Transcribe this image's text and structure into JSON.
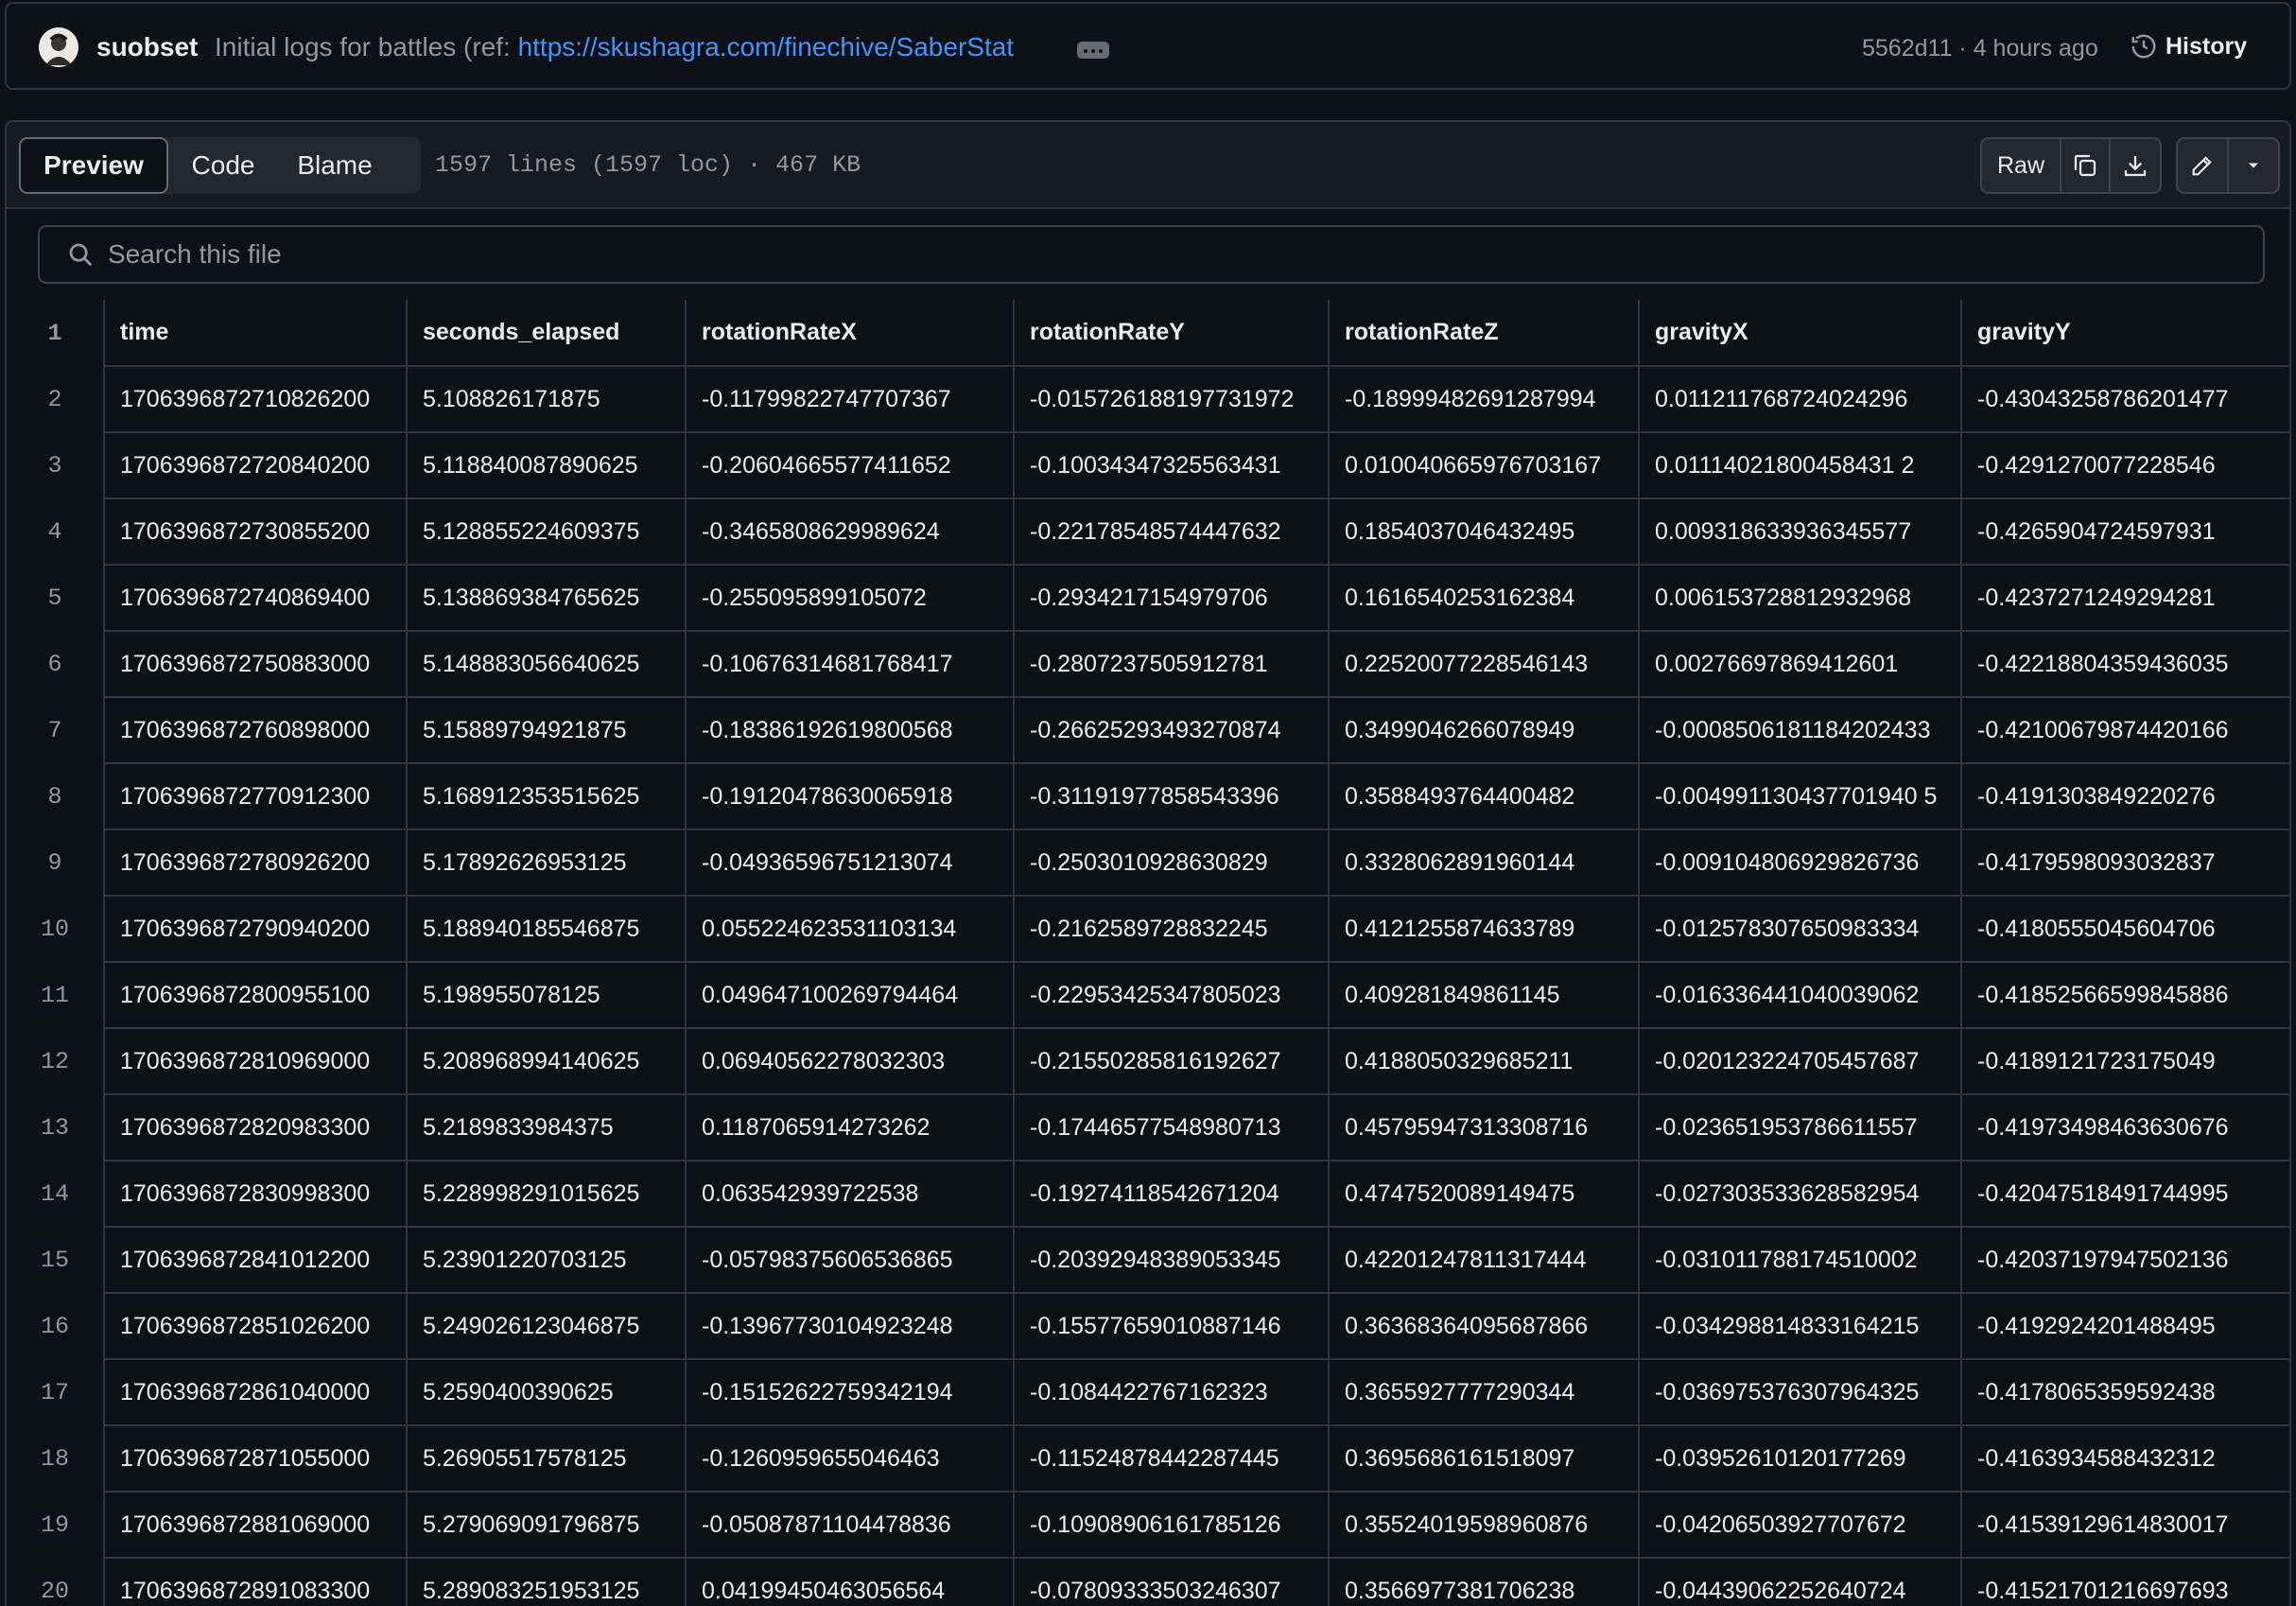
{
  "commit": {
    "author": "suobset",
    "message_prefix": "Initial logs for battles (ref: ",
    "message_link": "https://skushagra.com/finechive/SaberStat",
    "sha_time": "5562d11 · 4 hours ago",
    "history_label": "History"
  },
  "file_header": {
    "tabs": [
      "Preview",
      "Code",
      "Blame"
    ],
    "active_tab": "Preview",
    "info": "1597 lines (1597 loc) · 467 KB",
    "raw_label": "Raw"
  },
  "search": {
    "placeholder": "Search this file"
  },
  "table": {
    "header_line": "1",
    "columns": [
      "time",
      "seconds_elapsed",
      "rotationRateX",
      "rotationRateY",
      "rotationRateZ",
      "gravityX",
      "gravityY"
    ],
    "rows": [
      {
        "line": "2",
        "cells": [
          "1706396872710826200",
          "5.108826171875",
          "-0.11799822747707367",
          "-0.015726188197731972",
          "-0.18999482691287994",
          "0.011211768724024296",
          "-0.43043258786201477"
        ]
      },
      {
        "line": "3",
        "cells": [
          "1706396872720840200",
          "5.118840087890625",
          "-0.20604665577411652",
          "-0.10034347325563431",
          "0.010040665976703167",
          "0.01114021800458431 2",
          "-0.4291270077228546"
        ]
      },
      {
        "line": "4",
        "cells": [
          "1706396872730855200",
          "5.128855224609375",
          "-0.3465808629989624",
          "-0.22178548574447632",
          "0.1854037046432495",
          "0.009318633936345577",
          "-0.4265904724597931"
        ]
      },
      {
        "line": "5",
        "cells": [
          "1706396872740869400",
          "5.138869384765625",
          "-0.255095899105072",
          "-0.2934217154979706",
          "0.1616540253162384",
          "0.006153728812932968",
          "-0.4237271249294281"
        ]
      },
      {
        "line": "6",
        "cells": [
          "1706396872750883000",
          "5.148883056640625",
          "-0.10676314681768417",
          "-0.2807237505912781",
          "0.22520077228546143",
          "0.00276697869412601",
          "-0.42218804359436035"
        ]
      },
      {
        "line": "7",
        "cells": [
          "1706396872760898000",
          "5.15889794921875",
          "-0.18386192619800568",
          "-0.26625293493270874",
          "0.3499046266078949",
          "-0.0008506181184202433",
          "-0.42100679874420166"
        ]
      },
      {
        "line": "8",
        "cells": [
          "1706396872770912300",
          "5.168912353515625",
          "-0.19120478630065918",
          "-0.31191977858543396",
          "0.3588493764400482",
          "-0.004991130437701940 5",
          "-0.4191303849220276"
        ]
      },
      {
        "line": "9",
        "cells": [
          "1706396872780926200",
          "5.17892626953125",
          "-0.04936596751213074",
          "-0.2503010928630829",
          "0.3328062891960144",
          "-0.009104806929826736",
          "-0.4179598093032837"
        ]
      },
      {
        "line": "10",
        "cells": [
          "1706396872790940200",
          "5.188940185546875",
          "0.055224623531103134",
          "-0.2162589728832245",
          "0.4121255874633789",
          "-0.012578307650983334",
          "-0.4180555045604706"
        ]
      },
      {
        "line": "11",
        "cells": [
          "1706396872800955100",
          "5.198955078125",
          "0.049647100269794464",
          "-0.22953425347805023",
          "0.409281849861145",
          "-0.016336441040039062",
          "-0.41852566599845886"
        ]
      },
      {
        "line": "12",
        "cells": [
          "1706396872810969000",
          "5.208968994140625",
          "0.06940562278032303",
          "-0.21550285816192627",
          "0.4188050329685211",
          "-0.020123224705457687",
          "-0.4189121723175049"
        ]
      },
      {
        "line": "13",
        "cells": [
          "1706396872820983300",
          "5.2189833984375",
          "0.1187065914273262",
          "-0.17446577548980713",
          "0.45795947313308716",
          "-0.023651953786611557",
          "-0.41973498463630676"
        ]
      },
      {
        "line": "14",
        "cells": [
          "1706396872830998300",
          "5.228998291015625",
          "0.063542939722538",
          "-0.19274118542671204",
          "0.4747520089149475",
          "-0.027303533628582954",
          "-0.42047518491744995"
        ]
      },
      {
        "line": "15",
        "cells": [
          "1706396872841012200",
          "5.23901220703125",
          "-0.05798375606536865",
          "-0.20392948389053345",
          "0.42201247811317444",
          "-0.031011788174510002",
          "-0.42037197947502136"
        ]
      },
      {
        "line": "16",
        "cells": [
          "1706396872851026200",
          "5.249026123046875",
          "-0.13967730104923248",
          "-0.15577659010887146",
          "0.36368364095687866",
          "-0.034298814833164215",
          "-0.4192924201488495"
        ]
      },
      {
        "line": "17",
        "cells": [
          "1706396872861040000",
          "5.2590400390625",
          "-0.15152622759342194",
          "-0.1084422767162323",
          "0.3655927777290344",
          "-0.036975376307964325",
          "-0.4178065359592438"
        ]
      },
      {
        "line": "18",
        "cells": [
          "1706396872871055000",
          "5.26905517578125",
          "-0.1260959655046463",
          "-0.11524878442287445",
          "0.3695686161518097",
          "-0.03952610120177269",
          "-0.4163934588432312"
        ]
      },
      {
        "line": "19",
        "cells": [
          "1706396872881069000",
          "5.279069091796875",
          "-0.05087871104478836",
          "-0.10908906161785126",
          "0.35524019598960876",
          "-0.04206503927707672",
          "-0.41539129614830017"
        ]
      },
      {
        "line": "20",
        "cells": [
          "1706396872891083300",
          "5.289083251953125",
          "0.04199450463056564",
          "-0.07809333503246307",
          "0.3566977381706238",
          "-0.04439062252640724",
          "-0.41521701216697693"
        ]
      }
    ]
  }
}
